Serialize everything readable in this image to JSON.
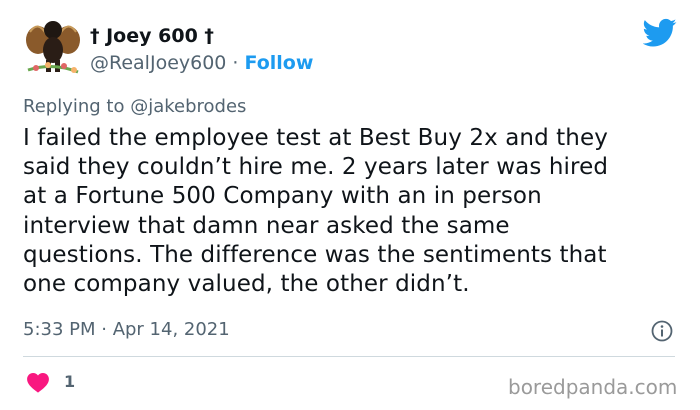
{
  "author": {
    "display_name": "† Joey 600 †",
    "handle": "@RealJoey600",
    "separator": " · ",
    "follow_label": "Follow"
  },
  "reply": {
    "prefix": "Replying to ",
    "mention": "@jakebrodes"
  },
  "tweet": {
    "lines": [
      "I failed the employee test at Best Buy 2x and they",
      "said they couldn’t hire me. 2 years later was hired",
      "at a Fortune 500 Company with an in person",
      "interview that damn near asked the same",
      "questions. The difference was the sentiments that",
      "one company valued, the other didn’t."
    ],
    "timestamp": "5:33 PM · Apr 14, 2021"
  },
  "engagement": {
    "likes": "1"
  },
  "watermark": "boredpanda.com",
  "colors": {
    "twitter_blue": "#1d9bf0",
    "heart_red": "#f91880",
    "secondary_text": "#536471"
  },
  "icons": [
    "avatar-cherub",
    "twitter-bird-icon",
    "info-icon",
    "heart-icon"
  ]
}
